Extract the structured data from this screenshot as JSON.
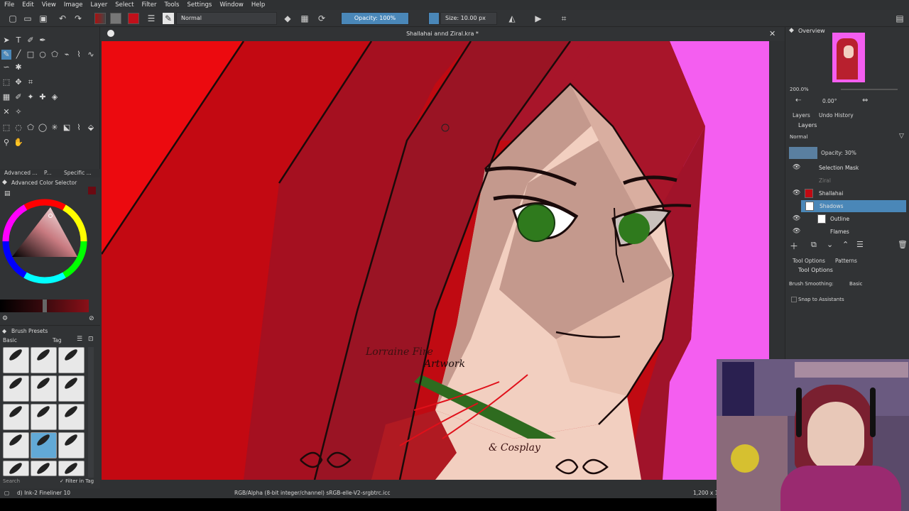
{
  "menu": [
    "File",
    "Edit",
    "View",
    "Image",
    "Layer",
    "Select",
    "Filter",
    "Tools",
    "Settings",
    "Window",
    "Help"
  ],
  "toolbar": {
    "blend_mode": "Normal",
    "opacity_label": "Opacity: 100%",
    "size_label": "Size: 10.00 px"
  },
  "document": {
    "title": "Shallahai annd Ziral.kra *"
  },
  "left_tabs": [
    "Advanced ...",
    "P...",
    "Specific ..."
  ],
  "color_selector": {
    "title": "Advanced Color Selector"
  },
  "brush_presets": {
    "title": "Brush Presets",
    "tag_filter": "Basic",
    "tag_label": "Tag",
    "search_placeholder": "Search",
    "filter_in_tag": "Filter in Tag"
  },
  "overview": {
    "title": "Overview",
    "zoom": "200.0%",
    "rotation": "0.00°"
  },
  "layers_tabs": [
    "Layers",
    "Undo History"
  ],
  "layers": {
    "title": "Layers",
    "blend_mode": "Normal",
    "opacity_label": "Opacity: 30%",
    "items": [
      {
        "name": "Selection Mask",
        "selected": false
      },
      {
        "name": "Ziral",
        "selected": false,
        "dim": true
      },
      {
        "name": "Shallahai",
        "selected": false
      },
      {
        "name": "Shadows",
        "selected": true
      },
      {
        "name": "Outline",
        "selected": false
      },
      {
        "name": "Flames",
        "selected": false
      }
    ]
  },
  "tool_options_tabs": [
    "Tool Options",
    "Patterns"
  ],
  "tool_options": {
    "title": "Tool Options",
    "brush_smoothing_label": "Brush Smoothing:",
    "brush_smoothing_value": "Basic",
    "snap_label": "Snap to Assistants"
  },
  "watermark": {
    "line1": "Lorraine Fire",
    "line2": "Artwork",
    "line3": "& Cosplay"
  },
  "status": {
    "brush": "d) Ink-2 Fineliner 10",
    "color_space": "RGB/Alpha (8-bit integer/channel)  sRGB-elle-V2-srgbtrc.icc",
    "coords": "1,200 x 1"
  },
  "colors": {
    "panel_bg": "#313335",
    "accent": "#4a87b8",
    "canvas_bg": "#f45ef0",
    "hair": "#b8202e",
    "skin": "#f2cfc0"
  }
}
